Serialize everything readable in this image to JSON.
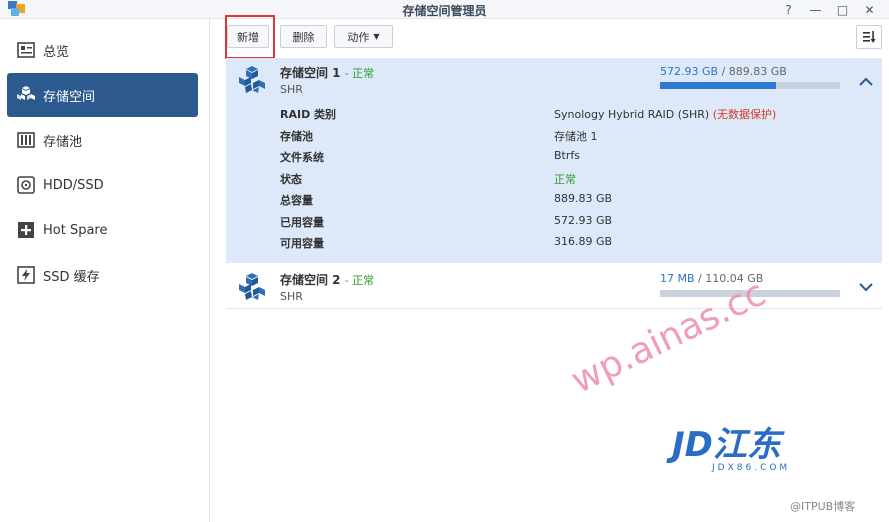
{
  "window": {
    "title": "存储空间管理员"
  },
  "winbtns": [
    "?",
    "—",
    "□",
    "✕"
  ],
  "sidebar": {
    "items": [
      {
        "label": "总览",
        "icon": "overview-icon"
      },
      {
        "label": "存储空间",
        "icon": "storage-volume-icon",
        "active": true
      },
      {
        "label": "存储池",
        "icon": "storage-pool-icon"
      },
      {
        "label": "HDD/SSD",
        "icon": "disk-icon"
      },
      {
        "label": "Hot Spare",
        "icon": "hot-spare-icon"
      },
      {
        "label": "SSD 缓存",
        "icon": "ssd-cache-icon"
      }
    ]
  },
  "toolbar": {
    "create": "新增",
    "delete": "删除",
    "action": "动作"
  },
  "volumes": [
    {
      "name": "存储空间 1",
      "status": "- 正常",
      "type": "SHR",
      "used": "572.93 GB",
      "total": "/ 889.83 GB",
      "fill_fraction": 0.644,
      "details": [
        {
          "k": "RAID 类别",
          "v": "Synology Hybrid RAID (SHR)",
          "extra": "(无数据保护)"
        },
        {
          "k": "存储池",
          "v": "存储池 1"
        },
        {
          "k": "文件系统",
          "v": "Btrfs"
        },
        {
          "k": "状态",
          "v": "正常"
        },
        {
          "k": "总容量",
          "v": "889.83 GB"
        },
        {
          "k": "已用容量",
          "v": "572.93 GB"
        },
        {
          "k": "可用容量",
          "v": "316.89 GB"
        }
      ]
    },
    {
      "name": "存储空间 2",
      "status": "- 正常",
      "type": "SHR",
      "used": "17 MB",
      "total": "/ 110.04 GB",
      "fill_fraction": 0.0
    }
  ],
  "watermark": {
    "text1": "wp.ainas.cc",
    "brand": "JD江东",
    "brand_sub": "JDX86.COM",
    "text2": "@ITPUB博客"
  },
  "colors": {
    "accent": "#2c5a8e",
    "ok": "#2e9c2e",
    "warn": "#d23a2a",
    "bar": "#2d79d3"
  }
}
